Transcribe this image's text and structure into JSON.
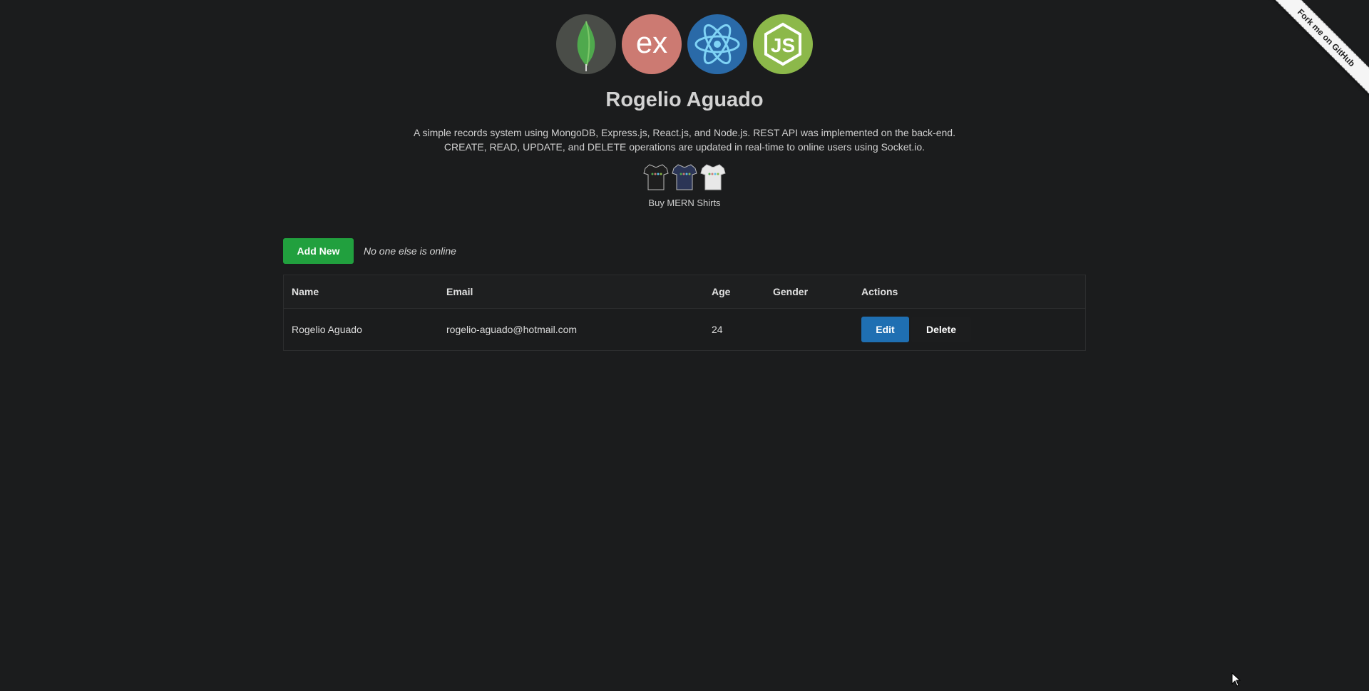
{
  "ribbon": {
    "label": "Fork me on GitHub"
  },
  "header": {
    "logos": [
      {
        "icon": "mongodb-leaf-icon",
        "bg": "#4a4d48"
      },
      {
        "icon": "express-ex-icon",
        "bg": "#cc7a72",
        "text": "ex"
      },
      {
        "icon": "react-atom-icon",
        "bg": "#2a6aa8"
      },
      {
        "icon": "nodejs-hex-icon",
        "bg": "#8cb84a",
        "text": "JS"
      }
    ],
    "title": "Rogelio Aguado",
    "description_line1": "A simple records system using MongoDB, Express.js, React.js, and Node.js. REST API was implemented on the back-end.",
    "description_line2": "CREATE, READ, UPDATE, and DELETE operations are updated in real-time to online users using Socket.io.",
    "shirts_caption": "Buy MERN Shirts"
  },
  "controls": {
    "add_label": "Add New",
    "online_status": "No one else is online"
  },
  "table": {
    "headers": [
      "Name",
      "Email",
      "Age",
      "Gender",
      "Actions"
    ],
    "rows": [
      {
        "name": "Rogelio Aguado",
        "email": "rogelio-aguado@hotmail.com",
        "age": "24",
        "gender": "",
        "edit_label": "Edit",
        "delete_label": "Delete"
      }
    ]
  },
  "colors": {
    "background": "#1b1c1d",
    "add_button": "#21a03e",
    "edit_button": "#1f6fb2"
  }
}
